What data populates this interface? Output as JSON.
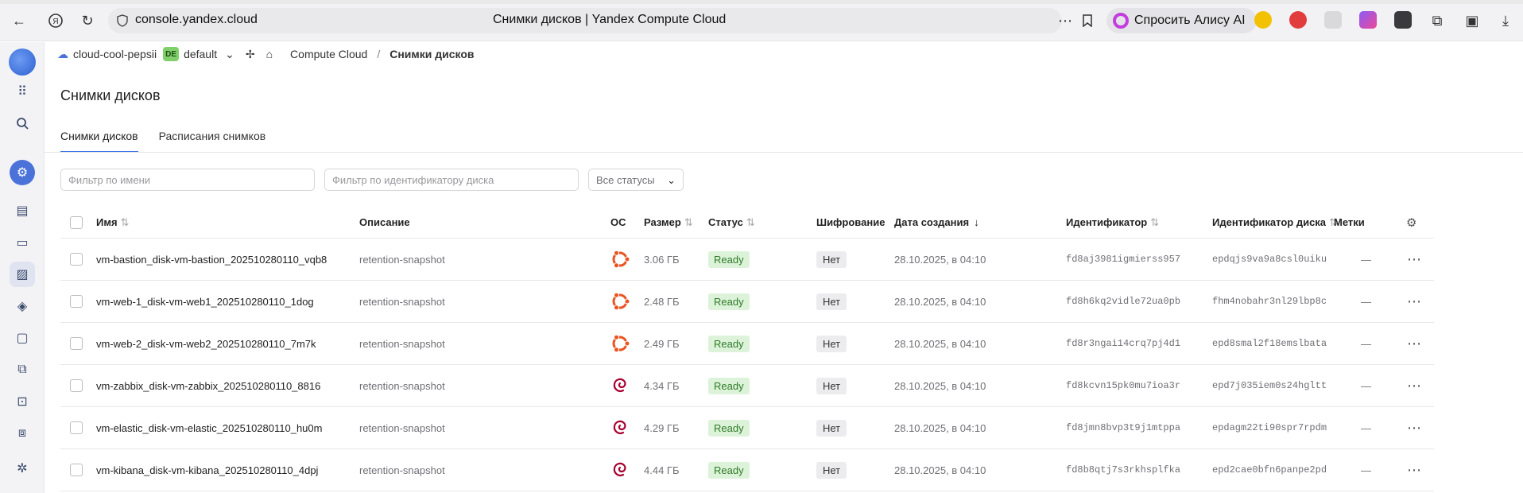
{
  "browser": {
    "url": "console.yandex.cloud",
    "page_title": "Снимки дисков | Yandex Compute Cloud",
    "alice_label": "Спросить Алису AI"
  },
  "breadcrumb": {
    "cloud": "cloud-cool-pepsii",
    "folder_badge": "DE",
    "folder": "default",
    "service": "Compute Cloud",
    "separator": "/",
    "current": "Снимки дисков"
  },
  "page": {
    "title": "Снимки дисков",
    "tabs": [
      "Снимки дисков",
      "Расписания снимков"
    ]
  },
  "filters": {
    "name_placeholder": "Фильтр по имени",
    "disk_id_placeholder": "Фильтр по идентификатору диска",
    "status_select": "Все статусы"
  },
  "table": {
    "headers": {
      "name": "Имя",
      "description": "Описание",
      "os": "ОС",
      "size": "Размер",
      "status": "Статус",
      "encryption": "Шифрование",
      "created": "Дата создания",
      "id": "Идентификатор",
      "disk_id": "Идентификатор диска",
      "labels": "Метки"
    },
    "rows": [
      {
        "name": "vm-bastion_disk-vm-bastion_202510280110_vqb8",
        "description": "retention-snapshot",
        "os": "ubuntu",
        "size": "3.06 ГБ",
        "status": "Ready",
        "encryption": "Нет",
        "created": "28.10.2025, в 04:10",
        "id": "fd8aj3981igmierss957",
        "disk_id": "epdqjs9va9a8csl0uiku",
        "labels": "—"
      },
      {
        "name": "vm-web-1_disk-vm-web1_202510280110_1dog",
        "description": "retention-snapshot",
        "os": "ubuntu",
        "size": "2.48 ГБ",
        "status": "Ready",
        "encryption": "Нет",
        "created": "28.10.2025, в 04:10",
        "id": "fd8h6kq2vidle72ua0pb",
        "disk_id": "fhm4nobahr3nl29lbp8c",
        "labels": "—"
      },
      {
        "name": "vm-web-2_disk-vm-web2_202510280110_7m7k",
        "description": "retention-snapshot",
        "os": "ubuntu",
        "size": "2.49 ГБ",
        "status": "Ready",
        "encryption": "Нет",
        "created": "28.10.2025, в 04:10",
        "id": "fd8r3ngai14crq7pj4d1",
        "disk_id": "epd8smal2f18emslbata",
        "labels": "—"
      },
      {
        "name": "vm-zabbix_disk-vm-zabbix_202510280110_8816",
        "description": "retention-snapshot",
        "os": "debian",
        "size": "4.34 ГБ",
        "status": "Ready",
        "encryption": "Нет",
        "created": "28.10.2025, в 04:10",
        "id": "fd8kcvn15pk0mu7ioa3r",
        "disk_id": "epd7j035iem0s24hgltt",
        "labels": "—"
      },
      {
        "name": "vm-elastic_disk-vm-elastic_202510280110_hu0m",
        "description": "retention-snapshot",
        "os": "debian",
        "size": "4.29 ГБ",
        "status": "Ready",
        "encryption": "Нет",
        "created": "28.10.2025, в 04:10",
        "id": "fd8jmn8bvp3t9j1mtppa",
        "disk_id": "epdagm22ti90spr7rpdm",
        "labels": "—"
      },
      {
        "name": "vm-kibana_disk-vm-kibana_202510280110_4dpj",
        "description": "retention-snapshot",
        "os": "debian",
        "size": "4.44 ГБ",
        "status": "Ready",
        "encryption": "Нет",
        "created": "28.10.2025, в 04:10",
        "id": "fd8b8qtj7s3rkhsplfka",
        "disk_id": "epd2cae0bfn6panpe2pd",
        "labels": "—"
      }
    ]
  },
  "colors": {
    "accent": "#3a73e8",
    "ready_bg": "#dcf3d9",
    "ubuntu": "#e95420",
    "debian": "#a80030"
  }
}
